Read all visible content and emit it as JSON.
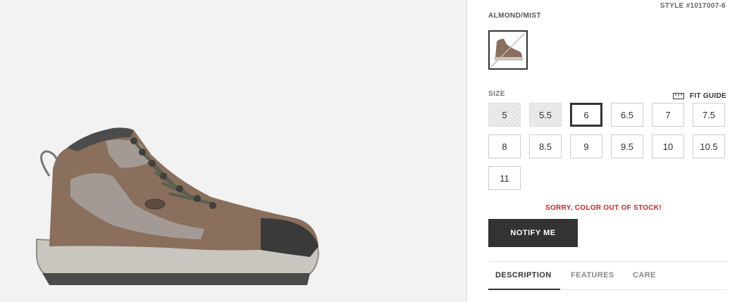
{
  "product": {
    "style_number": "STYLE #1017007-6",
    "color_name": "ALMOND/MIST",
    "swatch_icon": "boot-thumbnail-icon"
  },
  "size_section": {
    "label": "SIZE",
    "fit_guide": "FIT GUIDE",
    "fit_guide_icon": "ruler-icon",
    "sizes": [
      {
        "label": "5",
        "state": "unavailable"
      },
      {
        "label": "5.5",
        "state": "unavailable"
      },
      {
        "label": "6",
        "state": "selected"
      },
      {
        "label": "6.5",
        "state": "available"
      },
      {
        "label": "7",
        "state": "available"
      },
      {
        "label": "7.5",
        "state": "available"
      },
      {
        "label": "8",
        "state": "available"
      },
      {
        "label": "8.5",
        "state": "available"
      },
      {
        "label": "9",
        "state": "available"
      },
      {
        "label": "9.5",
        "state": "available"
      },
      {
        "label": "10",
        "state": "available"
      },
      {
        "label": "10.5",
        "state": "available"
      },
      {
        "label": "11",
        "state": "available"
      }
    ]
  },
  "stock_message": "SORRY, COLOR OUT OF STOCK!",
  "notify_button": "NOTIFY ME",
  "tabs": [
    {
      "label": "DESCRIPTION",
      "active": true
    },
    {
      "label": "FEATURES",
      "active": false
    },
    {
      "label": "CARE",
      "active": false
    }
  ],
  "colors": {
    "accent_dark": "#333333",
    "error_red": "#c62828",
    "gallery_bg": "#f2f2f2"
  }
}
